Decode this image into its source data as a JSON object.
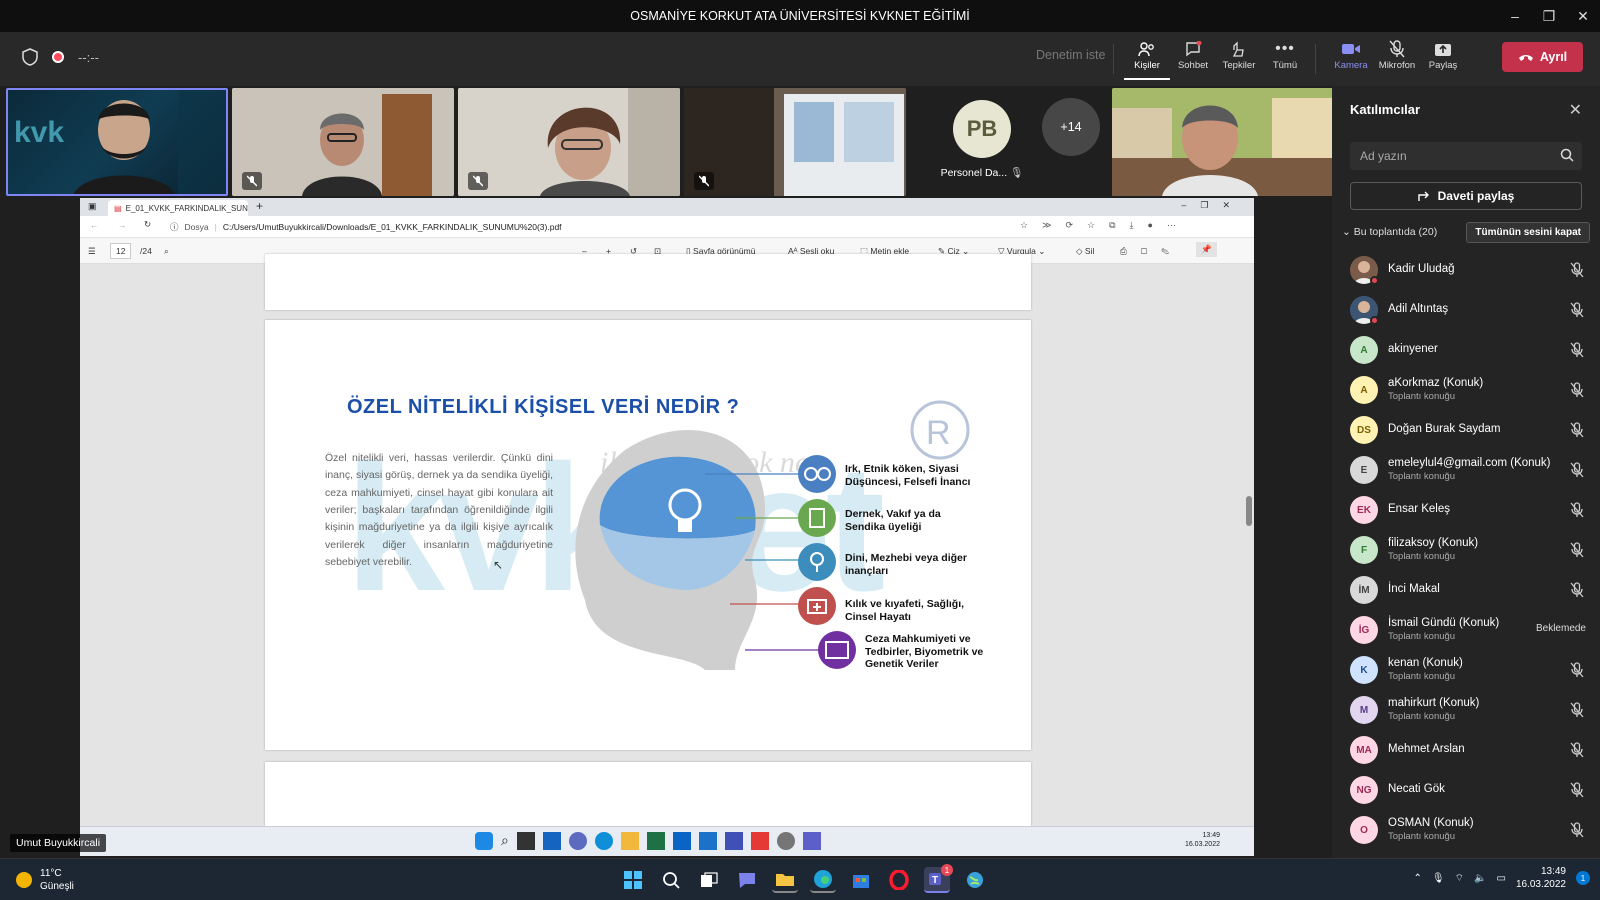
{
  "window": {
    "title": "OSMANİYE KORKUT ATA ÜNİVERSİTESİ KVKNET EĞİTİMİ"
  },
  "meeting_toolbar": {
    "timer": "--:--",
    "audit_label": "Denetim iste",
    "people": "Kişiler",
    "chat": "Sohbet",
    "reactions": "Tepkiler",
    "more": "Tümü",
    "camera": "Kamera",
    "mic": "Mikrofon",
    "share": "Paylaş",
    "leave": "Ayrıl"
  },
  "video_strip": {
    "pb_initials": "PB",
    "pb_name": "Personel Da...",
    "overflow": "+14",
    "self_label": "Umut Buyukkircali"
  },
  "browser": {
    "tab_title": "E_01_KVKK_FARKINDALIK_SUNU...",
    "file_label": "Dosya",
    "url": "C:/Users/UmutBuyukkircali/Downloads/E_01_KVKK_FARKINDALIK_SUNUMU%20(3).pdf"
  },
  "pdf_toolbar": {
    "page_current": "12",
    "page_total": "/24",
    "page_view": "Sayfa görünümü",
    "read_aloud": "Sesli oku",
    "add_text": "Metin ekle",
    "draw": "Çiz",
    "highlight": "Vurgula",
    "erase": "Sil"
  },
  "slide": {
    "title": "ÖZEL NİTELİKLİ KİŞİSEL VERİ NEDİR ?",
    "body": "Özel nitelikli veri, hassas verilerdir. Çünkü dini inanç, siyasi görüş, dernek ya da sendika üyeliği, ceza mahkumiyeti, cinsel hayat gibi konulara ait veriler; başkaları tarafından öğrenildiğinde ilgili kişinin mağduriyetine ya da ilgili kişiye ayrıcalık verilerek diğer insanların mağduriyetine sebebiyet verebilir.",
    "watermark": "kvknet",
    "watermark_sub": "ile her şey çok net",
    "reg_mark": "R",
    "items": [
      {
        "label": "Irk, Etnik köken, Siyasi Düşüncesi, Felsefi İnancı",
        "color": "#4a7fc1"
      },
      {
        "label": "Dernek, Vakıf ya da Sendika üyeliği",
        "color": "#6aa84f"
      },
      {
        "label": "Dini, Mezhebi veya diğer inançları",
        "color": "#3c8dbc"
      },
      {
        "label": "Kılık ve kıyafeti, Sağlığı, Cinsel Hayatı",
        "color": "#c0504d"
      },
      {
        "label": "Ceza Mahkumiyeti ve Tedbirler, Biyometrik ve Genetik Veriler",
        "color": "#7030a0"
      }
    ]
  },
  "inner_taskbar": {
    "time": "13:49",
    "date": "16.03.2022"
  },
  "participants": {
    "title": "Katılımcılar",
    "search_placeholder": "Ad yazın",
    "invite": "Daveti paylaş",
    "section": "Bu toplantıda (20)",
    "mute_all": "Tümünün sesini kapat",
    "list": [
      {
        "initials": "",
        "name": "Kadir Uludağ",
        "sub": "",
        "bg": "#7a5a48",
        "fg": "#fff",
        "dot": "#e74856",
        "status": "muted",
        "photo": true
      },
      {
        "initials": "",
        "name": "Adil Altıntaş",
        "sub": "",
        "bg": "#3b5573",
        "fg": "#fff",
        "dot": "#e74856",
        "status": "muted",
        "photo": true
      },
      {
        "initials": "A",
        "name": "akinyener",
        "sub": "",
        "bg": "#c8e6c9",
        "fg": "#2e7d32",
        "dot": "",
        "status": "muted"
      },
      {
        "initials": "A",
        "name": "aKorkmaz (Konuk)",
        "sub": "Toplantı konuğu",
        "bg": "#fff2b3",
        "fg": "#7a6000",
        "dot": "#cccccc",
        "status": "muted"
      },
      {
        "initials": "DS",
        "name": "Doğan Burak Saydam",
        "sub": "",
        "bg": "#fff2b3",
        "fg": "#7a6000",
        "dot": "",
        "status": "muted"
      },
      {
        "initials": "E",
        "name": "emeleylul4@gmail.com (Konuk)",
        "sub": "Toplantı konuğu",
        "bg": "#d9d9d9",
        "fg": "#444",
        "dot": "#cccccc",
        "status": "muted"
      },
      {
        "initials": "EK",
        "name": "Ensar Keleş",
        "sub": "",
        "bg": "#ffd6e4",
        "fg": "#9c2a55",
        "dot": "",
        "status": "muted"
      },
      {
        "initials": "F",
        "name": "filizaksoy (Konuk)",
        "sub": "Toplantı konuğu",
        "bg": "#c8e6c9",
        "fg": "#2e7d32",
        "dot": "#cccccc",
        "status": "muted"
      },
      {
        "initials": "İM",
        "name": "İnci Makal",
        "sub": "",
        "bg": "#d9d9d9",
        "fg": "#444",
        "dot": "#e74856",
        "status": "muted"
      },
      {
        "initials": "İG",
        "name": "İsmail Gündü (Konuk)",
        "sub": "Toplantı konuğu",
        "bg": "#ffd6e4",
        "fg": "#9c2a55",
        "dot": "#cccccc",
        "status": "waiting"
      },
      {
        "initials": "K",
        "name": "kenan (Konuk)",
        "sub": "Toplantı konuğu",
        "bg": "#cfe2ff",
        "fg": "#1e4f91",
        "dot": "#cccccc",
        "status": "muted"
      },
      {
        "initials": "M",
        "name": "mahirkurt (Konuk)",
        "sub": "Toplantı konuğu",
        "bg": "#e1d5f0",
        "fg": "#5b3a8c",
        "dot": "#cccccc",
        "status": "muted"
      },
      {
        "initials": "MA",
        "name": "Mehmet Arslan",
        "sub": "",
        "bg": "#ffd6e4",
        "fg": "#9c2a55",
        "dot": "",
        "status": "muted"
      },
      {
        "initials": "NG",
        "name": "Necati Gök",
        "sub": "",
        "bg": "#ffd6e4",
        "fg": "#9c2a55",
        "dot": "",
        "status": "muted"
      },
      {
        "initials": "O",
        "name": "OSMAN (Konuk)",
        "sub": "Toplantı konuğu",
        "bg": "#ffd6e4",
        "fg": "#9c2a55",
        "dot": "#cccccc",
        "status": "muted"
      }
    ],
    "waiting_label": "Beklemede"
  },
  "os_taskbar": {
    "temp": "11°C",
    "weather": "Güneşli",
    "time": "13:49",
    "date": "16.03.2022",
    "badge": "1"
  }
}
